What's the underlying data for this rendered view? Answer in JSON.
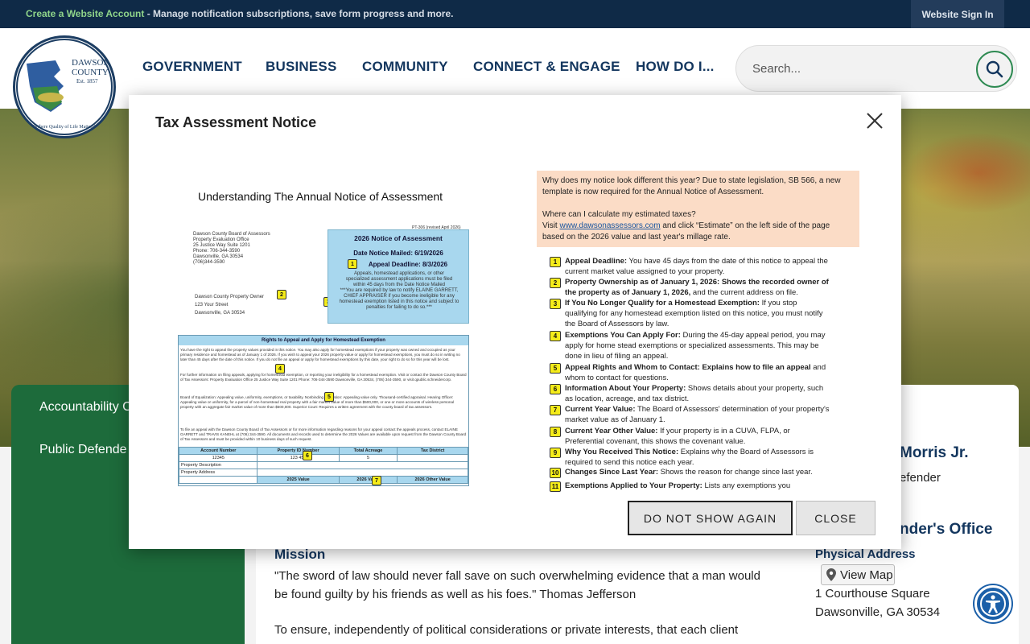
{
  "topbar": {
    "create_link": "Create a Website Account",
    "create_rest": " - Manage notification subscriptions, save form progress and more.",
    "signin": "Website Sign In"
  },
  "logo": {
    "line1": "DAWSON",
    "line2": "COUNTY",
    "est": "Est. 1857",
    "motto": "\"Where Quality of Life Matters\""
  },
  "nav": [
    "GOVERNMENT",
    "BUSINESS",
    "COMMUNITY",
    "CONNECT & ENGAGE",
    "HOW DO I..."
  ],
  "search": {
    "placeholder": "Search..."
  },
  "sidebar": {
    "items": [
      "Accountability C",
      "Public Defende"
    ]
  },
  "main": {
    "mission_title": "Mission",
    "quote1": "\"The sword of law should never fall save on such overwhelming evidence that a man would",
    "quote2": "be found guilty by his friends as well as his foes.\" Thomas Jefferson",
    "para": "To ensure, independently of political considerations or private interests, that each client"
  },
  "right": {
    "name": "Morris Jr.",
    "role": "efender",
    "office": "nder's Office",
    "phys_label": "Physical Address",
    "viewmap": "View Map",
    "addr1": "1 Courthouse Square",
    "addr2": "Dawsonville, GA 30534"
  },
  "modal": {
    "title": "Tax Assessment Notice",
    "notice_title": "Understanding The Annual Notice of Assessment",
    "form_id": "PT-306 (revised April 2026)",
    "office_lines": [
      "Dawson County Board of Assessors",
      "Property Evaluation Office",
      "25 Justice Way Suite 1201",
      "Phone: 706-344-3590",
      "Dawsonville, GA 30534",
      "(706)344-3590"
    ],
    "owner_lines": [
      "Dawson County Property Owner",
      "123 Your Street",
      "Dawsonville, GA 30534"
    ],
    "blue_title": "2026 Notice of Assessment",
    "date_mailed": "Date Notice Mailed: 6/19/2026",
    "appeal_deadline": "Appeal Deadline: 8/3/2026",
    "blue_text": "Appeals, homestead applications, or other specialized assessment applications must be filed within 45 days from the Date Notice Mailed",
    "blue_warn": "***You are required by law to notify ELAINE GARRETT, CHIEF APPRAISER if you become ineligible for any homestead exemption listed in this notice and subject to penalties for failing to do so.***",
    "rights_title": "Rights to Appeal and Apply for Homestead Exemption",
    "rights_text1": "You have the right to appeal the property values provided in this notice. You may also apply for homestead exemptions if your property was owned and occupied as your primary residence and homestead as of January 1 of 2026. If you wish to appeal your 2026 property value or apply for homestead exemptions, you must do so in writing no later than 45 days after the date of this notice. If you do not file an appeal or apply for homestead exemptions by this date, your right to do so for this year will be lost.",
    "rights_text2": "For further information on filing appeals, applying for homestead exemption, or reporting your ineligibility for a homestead exemption. Visit or contact the Dawson County Board of Tax Assessors: Property Evaluation Office 25 Justice Way Suite 1201 Phone: 706-344-3590 Dawsonville, GA 30534, (706) 344-3590, or visit qpublic.schneidercorp.",
    "rights_text3": "Board of Equalization: Appealing value, uniformity, exemptions, or taxability. Nonbinding Arbitration: Appealing value only. Thousand-certified appraisal. Hearing Officer: Appealing value or uniformity, for a parcel of non-homestead real property with a fair market value of more than $500,000, or one or more accounts of wireless personal property with an aggregate fair market value of more than $500,000. Superior Court: Requires a written agreement with the county board of tax assessors.",
    "rights_text4": "To file an appeal with the Dawson County Board of Tax Assessors or for more information regarding reasons for your appeal contact the appeals process, contact ELAINE GARRETT and TRAVIS KANEHL at (706) 344-3590. All documents and records used to determine the 2026 Values are available upon request from the Dawson County Board of Tax Assessors and must be provided within 10 business days of such request.",
    "table_headers": [
      "Account Number",
      "Property ID Number",
      "Total Acreage",
      "Tax District"
    ],
    "table_values": [
      "12345",
      "123 456",
      "5",
      ""
    ],
    "row_desc": "Property Description",
    "row_addr": "Property Address",
    "value_headers": [
      "2025 Value",
      "2026 Value",
      "2026 Other Value"
    ],
    "peach_q1": "Why does my notice look different this year? Due to state legislation, SB 566, a new template is now required for the Annual Notice of Assessment.",
    "peach_q2": "Where can I calculate my estimated taxes?",
    "peach_visit": "Visit ",
    "peach_link": "www.dawsonassessors.com",
    "peach_rest": " and click “Estimate” on the left side of the page based on the 2026 value and last year's millage rate.",
    "explanations": [
      {
        "num": "1",
        "bold": "Appeal Deadline:",
        "text": " You have 45 days from the date of this notice to appeal the current market value assigned to your property."
      },
      {
        "num": "2",
        "bold": "Property Ownership as of January 1, 2026: Shows the recorded owner of the property as of January 1, 2026,",
        "text": " and the current address on file."
      },
      {
        "num": "3",
        "bold": "If You No Longer Qualify for a Homestead Exemption:",
        "text": " If you stop qualifying for any homestead exemption listed on this notice, you must notify the Board of Assessors by law."
      },
      {
        "num": "4",
        "bold": "Exemptions You Can Apply For:",
        "text": " During the 45-day appeal period, you may apply for home stead exemptions or specialized assessments. This may be done in lieu of filing an appeal."
      },
      {
        "num": "5",
        "bold": "Appeal Rights and Whom to Contact: Explains how to file an appeal",
        "text": " and whom to contact for questions."
      },
      {
        "num": "6",
        "bold": "Information About Your Property:",
        "text": " Shows details about your property, such as location, acreage, and tax district."
      },
      {
        "num": "7",
        "bold": "Current Year Value:",
        "text": " The Board of Assessors' determination of your property's market value as of January 1."
      },
      {
        "num": "8",
        "bold": "Current Year Other Value:",
        "text": " If your property is in a CUVA, FLPA, or Preferential covenant, this shows the covenant value."
      },
      {
        "num": "9",
        "bold": "Why You Received This Notice:",
        "text": " Explains why the Board of Assessors is required to send this notice each year."
      },
      {
        "num": "10",
        "bold": "Changes Since Last Year:",
        "text": " Shows the reason for change since last year."
      },
      {
        "num": "11",
        "bold": "Exemptions Applied to Your Property:",
        "text": " Lists any exemptions you"
      }
    ],
    "btn_dont_show": "DO NOT SHOW AGAIN",
    "btn_close": "CLOSE"
  }
}
